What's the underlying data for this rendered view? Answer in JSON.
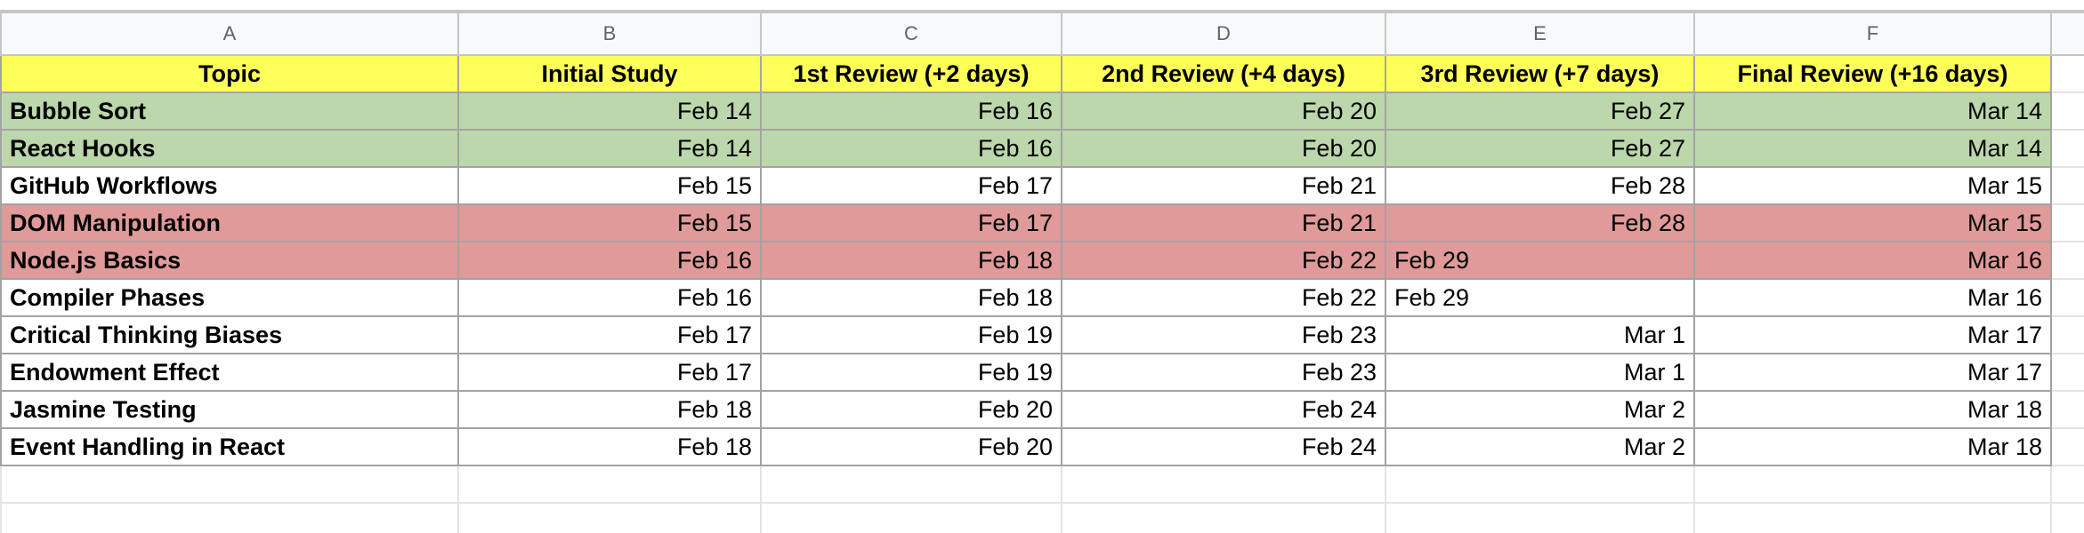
{
  "columns": [
    "A",
    "B",
    "C",
    "D",
    "E",
    "F"
  ],
  "header_row": [
    "Topic",
    "Initial Study",
    "1st Review (+2 days)",
    "2nd Review (+4 days)",
    "3rd Review (+7 days)",
    "Final Review (+16 days)"
  ],
  "rows": [
    {
      "topic": "Bubble Sort",
      "dates": [
        "Feb 14",
        "Feb 16",
        "Feb 20",
        "Feb 27",
        "Mar 14"
      ],
      "highlight": "green"
    },
    {
      "topic": "React Hooks",
      "dates": [
        "Feb 14",
        "Feb 16",
        "Feb 20",
        "Feb 27",
        "Mar 14"
      ],
      "highlight": "green"
    },
    {
      "topic": "GitHub Workflows",
      "dates": [
        "Feb 15",
        "Feb 17",
        "Feb 21",
        "Feb 28",
        "Mar 15"
      ],
      "highlight": "none"
    },
    {
      "topic": "DOM Manipulation",
      "dates": [
        "Feb 15",
        "Feb 17",
        "Feb 21",
        "Feb 28",
        "Mar 15"
      ],
      "highlight": "red"
    },
    {
      "topic": "Node.js Basics",
      "dates": [
        "Feb 16",
        "Feb 18",
        "Feb 22",
        "Feb 29",
        "Mar 16"
      ],
      "highlight": "red"
    },
    {
      "topic": "Compiler Phases",
      "dates": [
        "Feb 16",
        "Feb 18",
        "Feb 22",
        "Feb 29",
        "Mar 16"
      ],
      "highlight": "none"
    },
    {
      "topic": "Critical Thinking Biases",
      "dates": [
        "Feb 17",
        "Feb 19",
        "Feb 23",
        "Mar 1",
        "Mar 17"
      ],
      "highlight": "none"
    },
    {
      "topic": "Endowment Effect",
      "dates": [
        "Feb 17",
        "Feb 19",
        "Feb 23",
        "Mar 1",
        "Mar 17"
      ],
      "highlight": "none"
    },
    {
      "topic": "Jasmine Testing",
      "dates": [
        "Feb 18",
        "Feb 20",
        "Feb 24",
        "Mar 2",
        "Mar 18"
      ],
      "highlight": "none"
    },
    {
      "topic": "Event Handling in React",
      "dates": [
        "Feb 18",
        "Feb 20",
        "Feb 24",
        "Mar 2",
        "Mar 18"
      ],
      "highlight": "none"
    }
  ],
  "colors": {
    "header_fill": "#ffff5a",
    "green_fill": "#bcd7ab",
    "red_fill": "#e09a9a",
    "column_header_fill": "#f8f9fa"
  }
}
